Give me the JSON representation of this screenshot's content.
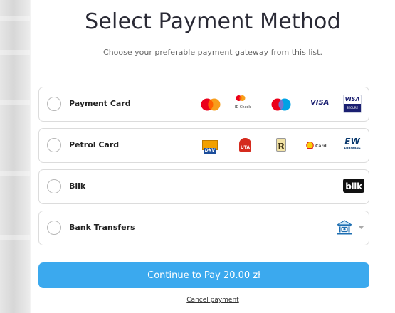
{
  "header": {
    "title": "Select Payment Method",
    "subtitle": "Choose your preferable payment gateway from this list."
  },
  "options": [
    {
      "label": "Payment Card",
      "icons": [
        "mastercard-logo",
        "id-check-logo",
        "maestro-logo",
        "visa-logo",
        "visa-secure-logo"
      ]
    },
    {
      "label": "Petrol Card",
      "icons": [
        "dkv-logo",
        "uta-logo",
        "routex-logo",
        "shell-card-logo",
        "eurowag-logo"
      ]
    },
    {
      "label": "Blik",
      "icons": [
        "blik-logo"
      ]
    },
    {
      "label": "Bank Transfers",
      "icons": [
        "bank-icon",
        "chevron-down-icon"
      ]
    }
  ],
  "logos": {
    "id_check": "ID Check",
    "visa": "VISA",
    "visa_secure_top": "VISA",
    "visa_secure_bottom": "SECURE",
    "dkv": "DKV",
    "uta": "UTA",
    "routex": "R",
    "shell_card": "Card",
    "eurowag_top": "EW",
    "eurowag_bottom": "EUROWAG",
    "blik": "blik"
  },
  "actions": {
    "pay_label": "Continue to Pay 20.00 zł",
    "cancel_label": "Cancel payment"
  },
  "colors": {
    "accent": "#3ba9ee",
    "mastercard_red": "#eb001b",
    "mastercard_orange": "#f79e1b",
    "maestro_blue": "#00a2e5",
    "visa_blue": "#1a1f71"
  }
}
